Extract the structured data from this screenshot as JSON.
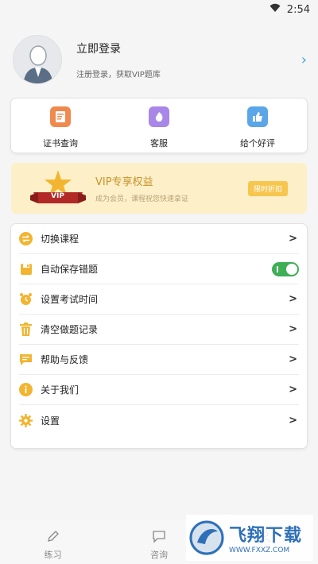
{
  "status": {
    "time": "2:54"
  },
  "profile": {
    "title": "立即登录",
    "subtitle": "注册登录，获取VIP题库",
    "arrow": "›"
  },
  "quick_actions": [
    {
      "label": "证书查询",
      "icon": "certificate-icon",
      "color": "#f0894e"
    },
    {
      "label": "客服",
      "icon": "customer-service-icon",
      "color": "#a887e8"
    },
    {
      "label": "给个好评",
      "icon": "thumbs-up-icon",
      "color": "#5aa6e8"
    }
  ],
  "vip": {
    "badge_text": "VIP",
    "title": "VIP专享权益",
    "subtitle": "成为会员，课程祝您快速拿证",
    "button": "限时折扣"
  },
  "menu": [
    {
      "label": "切换课程",
      "icon": "switch-icon"
    },
    {
      "label": "自动保存错题",
      "icon": "save-icon",
      "toggle": true
    },
    {
      "label": "设置考试时间",
      "icon": "alarm-clock-icon"
    },
    {
      "label": "清空做题记录",
      "icon": "trash-icon"
    },
    {
      "label": "帮助与反馈",
      "icon": "feedback-icon"
    },
    {
      "label": "关于我们",
      "icon": "info-icon"
    },
    {
      "label": "设置",
      "icon": "gear-icon"
    }
  ],
  "tabs": [
    {
      "label": "练习",
      "icon": "pencil-icon"
    },
    {
      "label": "咨询",
      "icon": "chat-icon"
    },
    {
      "label": "",
      "icon": "user-icon"
    }
  ],
  "watermark": {
    "title": "飞翔下载",
    "url": "WWW.FXXZ.COM"
  },
  "colors": {
    "accent_yellow": "#f6c64f",
    "toggle_on": "#3fae55",
    "vip_bg": "#fdf0c8"
  }
}
